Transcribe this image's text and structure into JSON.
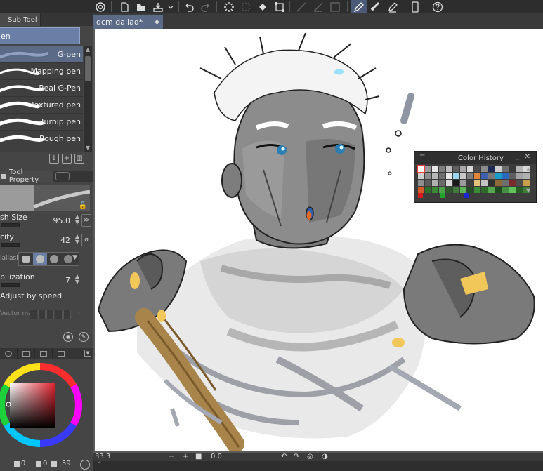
{
  "document": {
    "tab_title": "dcm dailad*"
  },
  "sub_tool": {
    "panel_tab": "Sub Tool",
    "group_label": "en",
    "brushes": [
      {
        "label": "G-pen",
        "selected": true
      },
      {
        "label": "Mapping pen",
        "selected": false
      },
      {
        "label": "Real G-Pen",
        "selected": false
      },
      {
        "label": "Textured pen",
        "selected": false
      },
      {
        "label": "Turnip pen",
        "selected": false
      },
      {
        "label": "Rough pen",
        "selected": false
      }
    ]
  },
  "tool_property": {
    "panel_tab": "Tool Property",
    "brush_size": {
      "label": "sh Size",
      "value": "95.0"
    },
    "opacity": {
      "label": "city",
      "value": "42"
    },
    "antialiasing": {
      "label": "ialiasi"
    },
    "stabilization": {
      "label": "bilization",
      "value": "7"
    },
    "adjust_by_speed": {
      "label": "Adjust by speed"
    },
    "vector": {
      "label": "Vector ma"
    }
  },
  "color": {
    "main_hue": "#e0232f",
    "hsv_readout": {
      "h": "0",
      "s": "0",
      "v": "59"
    }
  },
  "status": {
    "zoom": "33.3",
    "rotation": "0.0"
  },
  "color_history": {
    "title": "Color History",
    "rows": [
      [
        "#ffffff",
        "#9a9a9a",
        "#e6e6e6",
        "#7d7d7d",
        "#bdbdbd",
        "#5e5e5e",
        "#a8a8a8",
        "#d9d9d9",
        "#4a4a4a",
        "#8a8a8a",
        "#1e2c55",
        "#cfcfcf",
        "#6e6e6e",
        "#3a3a3a",
        "#b5b5b5",
        "#d8d8d8"
      ],
      [
        "#cfcfcf",
        "#8d8d8d",
        "#b6b6b6",
        "#6d6d6d",
        "#e8e8e8",
        "#9dd7ee",
        "#c7c7c7",
        "#7b7b7b",
        "#e0863c",
        "#3e5fb0",
        "#777777",
        "#1a9cc9",
        "#2a6bbd",
        "#5e5e5e",
        "#a3a3a3",
        "#b0b0b0"
      ],
      [
        "#8f8f8f",
        "#5b5b5b",
        "#b0b0b0",
        "#6a6a6a",
        "#d6d6d6",
        "#1a1a1a",
        "#9b9b9b",
        "#3e3e3e",
        "#e3c27b",
        "#c4c4c4",
        "#2f2f2f",
        "#8c6a3a",
        "#6f6f6f",
        "#7a2b2b",
        "#4d4d4d",
        "#c8a04a"
      ],
      [
        "#d65a2a",
        "#2d6e2a",
        "#3a8a35",
        "#4ea24a",
        "#2e5a2a",
        "#3f7a3a",
        "#5bb556",
        "#244d22",
        "#3b8c36",
        "#2d6a2a",
        "#55a850",
        "#1f4a1d",
        "#468f42",
        "#62c25c",
        "#2a5e27",
        "#3d7d39"
      ]
    ],
    "footer_colors": [
      "#d41c1c",
      "#22a12c",
      "#1c23d4"
    ]
  }
}
